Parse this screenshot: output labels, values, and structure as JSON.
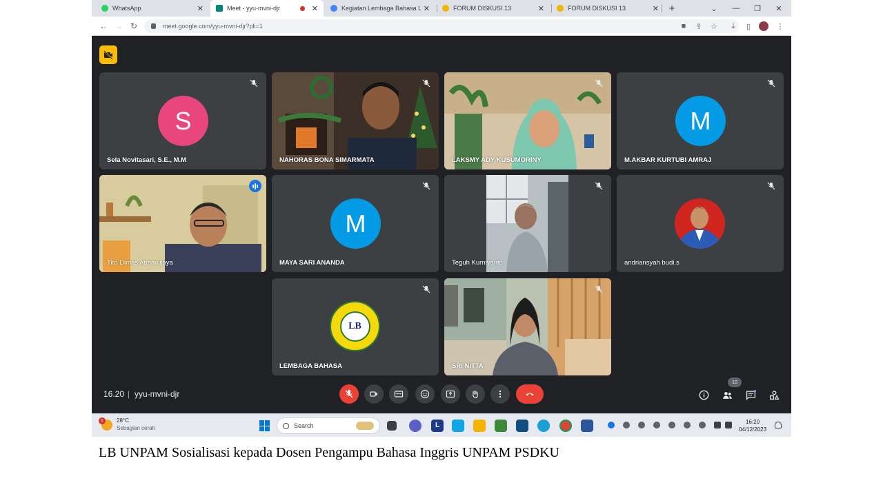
{
  "browser": {
    "tabs": [
      {
        "label": "WhatsApp",
        "active": false,
        "favicon_color": "#25d366"
      },
      {
        "label": "Meet - yyu-mvni-djr",
        "active": true,
        "favicon_color": "#00897b",
        "recording": true
      },
      {
        "label": "Kegiatan Lembaga Bahasa Unp",
        "active": false,
        "favicon_color": "#4285f4"
      },
      {
        "label": "FORUM DISKUSI 13",
        "active": false,
        "favicon_color": "#f4b400"
      },
      {
        "label": "FORUM DISKUSI 13",
        "active": false,
        "favicon_color": "#f4b400"
      }
    ],
    "url": "meet.google.com/yyu-mvni-djr?pli=1"
  },
  "meet": {
    "participants": [
      {
        "name": "Sela Novitasari, S.E., M.M",
        "initial": "S",
        "avatar_color": "#e8467c",
        "type": "avatar",
        "muted": true
      },
      {
        "name": "NAHORAS BONA SIMARMATA",
        "type": "video",
        "muted": true
      },
      {
        "name": "LAKSMY ADY KUSUMORINY",
        "type": "video",
        "muted": true
      },
      {
        "name": "M.AKBAR KURTUBI AMRAJ",
        "initial": "M",
        "avatar_color": "#039be5",
        "type": "avatar",
        "muted": true
      },
      {
        "name": "Tito Dimas Atmawijaya",
        "type": "video",
        "speaking": true
      },
      {
        "name": "MAYA SARI ANANDA",
        "initial": "M",
        "avatar_color": "#039be5",
        "type": "avatar",
        "muted": true
      },
      {
        "name": "Teguh Kurniyanto",
        "type": "video",
        "muted": true
      },
      {
        "name": "andriansyah budi.s",
        "type": "photo",
        "muted": true
      },
      {
        "name": "LEMBAGA BAHASA",
        "type": "logo",
        "muted": true,
        "logo_text": "LB"
      },
      {
        "name": "SRI NITTA",
        "type": "video",
        "muted": true
      }
    ],
    "time": "16.20",
    "separator": "|",
    "meeting_code": "yyu-mvni-djr",
    "participant_count": "10",
    "colors": {
      "background": "#202124",
      "tile": "#3c4043",
      "end_call": "#ea4335",
      "cam_off": "#fbbc04"
    }
  },
  "taskbar": {
    "weather_temp": "28°C",
    "weather_condition": "Sebagian cerah",
    "weather_alert": "1",
    "search_placeholder": "Search",
    "clock_time": "16:20",
    "clock_date": "04/12/2023"
  },
  "caption": "LB UNPAM Sosialisasi kepada Dosen Pengampu Bahasa Inggris UNPAM PSDKU"
}
